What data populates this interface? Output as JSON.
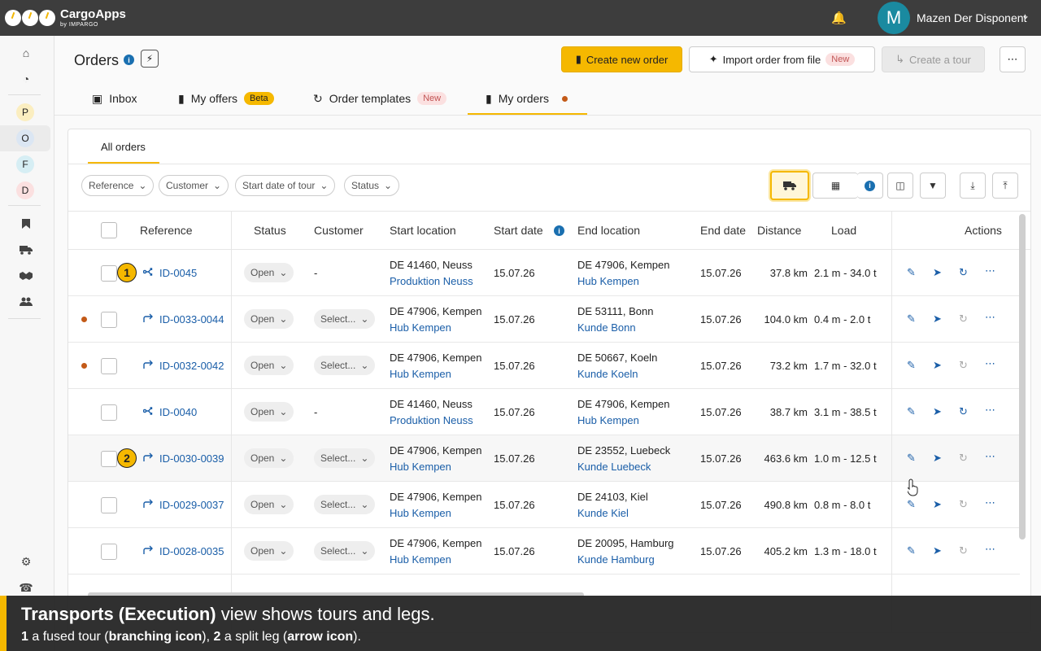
{
  "header": {
    "brand": "CargoApps",
    "brand_sub": "by IMPARGO",
    "avatar_letter": "M",
    "username": "Mazen Der Disponent"
  },
  "sidebar": {
    "letters": [
      "P",
      "O",
      "F",
      "D"
    ],
    "letter_colors": [
      "#fbeec0",
      "#dbe6f3",
      "#d6eef4",
      "#fbe0e0"
    ]
  },
  "page": {
    "title": "Orders",
    "create_order": "Create new order",
    "import_order": "Import order from file",
    "import_badge": "New",
    "create_tour": "Create a tour"
  },
  "tabs": [
    {
      "label": "Inbox",
      "badge": ""
    },
    {
      "label": "My offers",
      "badge": "Beta"
    },
    {
      "label": "Order templates",
      "badge": "New"
    },
    {
      "label": "My orders",
      "badge": ""
    }
  ],
  "subtab": "All orders",
  "filters": [
    "Reference",
    "Customer",
    "Start date of tour",
    "Status"
  ],
  "columns": {
    "reference": "Reference",
    "status": "Status",
    "customer": "Customer",
    "start_location": "Start location",
    "start_date": "Start date",
    "end_location": "End location",
    "end_date": "End date",
    "distance": "Distance",
    "load": "Load",
    "actions": "Actions"
  },
  "rows": [
    {
      "badge": "1",
      "dot": false,
      "type": "tour",
      "ref": "ID-0045",
      "status": "Open",
      "customer": "-",
      "start_city": "DE 41460, Neuss",
      "start_site": "Produktion Neuss",
      "start_date": "15.07.26",
      "end_city": "DE 47906, Kempen",
      "end_site": "Hub Kempen",
      "end_date": "15.07.26",
      "distance": "37.8 km",
      "load": "2.1 m - 34.0 t"
    },
    {
      "badge": "",
      "dot": true,
      "type": "leg",
      "ref": "ID-0033-0044",
      "status": "Open",
      "customer": "Select...",
      "start_city": "DE 47906, Kempen",
      "start_site": "Hub Kempen",
      "start_date": "15.07.26",
      "end_city": "DE 53111, Bonn",
      "end_site": "Kunde Bonn",
      "end_date": "15.07.26",
      "distance": "104.0 km",
      "load": "0.4 m - 2.0 t"
    },
    {
      "badge": "",
      "dot": true,
      "type": "leg",
      "ref": "ID-0032-0042",
      "status": "Open",
      "customer": "Select...",
      "start_city": "DE 47906, Kempen",
      "start_site": "Hub Kempen",
      "start_date": "15.07.26",
      "end_city": "DE 50667, Koeln",
      "end_site": "Kunde Koeln",
      "end_date": "15.07.26",
      "distance": "73.2 km",
      "load": "1.7 m - 32.0 t"
    },
    {
      "badge": "",
      "dot": false,
      "type": "tour",
      "ref": "ID-0040",
      "status": "Open",
      "customer": "-",
      "start_city": "DE 41460, Neuss",
      "start_site": "Produktion Neuss",
      "start_date": "15.07.26",
      "end_city": "DE 47906, Kempen",
      "end_site": "Hub Kempen",
      "end_date": "15.07.26",
      "distance": "38.7 km",
      "load": "3.1 m - 38.5 t"
    },
    {
      "badge": "2",
      "dot": false,
      "type": "leg",
      "ref": "ID-0030-0039",
      "status": "Open",
      "customer": "Select...",
      "start_city": "DE 47906, Kempen",
      "start_site": "Hub Kempen",
      "start_date": "15.07.26",
      "end_city": "DE 23552, Luebeck",
      "end_site": "Kunde Luebeck",
      "end_date": "15.07.26",
      "distance": "463.6 km",
      "load": "1.0 m - 12.5 t"
    },
    {
      "badge": "",
      "dot": false,
      "type": "leg",
      "ref": "ID-0029-0037",
      "status": "Open",
      "customer": "Select...",
      "start_city": "DE 47906, Kempen",
      "start_site": "Hub Kempen",
      "start_date": "15.07.26",
      "end_city": "DE 24103, Kiel",
      "end_site": "Kunde Kiel",
      "end_date": "15.07.26",
      "distance": "490.8 km",
      "load": "0.8 m - 8.0 t"
    },
    {
      "badge": "",
      "dot": false,
      "type": "leg",
      "ref": "ID-0028-0035",
      "status": "Open",
      "customer": "Select...",
      "start_city": "DE 47906, Kempen",
      "start_site": "Hub Kempen",
      "start_date": "15.07.26",
      "end_city": "DE 20095, Hamburg",
      "end_site": "Kunde Hamburg",
      "end_date": "15.07.26",
      "distance": "405.2 km",
      "load": "1.3 m - 18.0 t"
    }
  ],
  "caption": {
    "line1_bold": "Transports (Execution)",
    "line1_rest": " view shows tours and legs.",
    "line2_n1": "1",
    "line2_a": " a fused tour (",
    "line2_b1": "branching icon",
    "line2_c": "), ",
    "line2_n2": "2",
    "line2_d": " a split leg (",
    "line2_b2": "arrow icon",
    "line2_e": ")."
  },
  "colors": {
    "accent": "#f5b800",
    "link": "#1a5ea8",
    "topbar": "#3d3d3d",
    "unread_dot": "#c35a18"
  }
}
